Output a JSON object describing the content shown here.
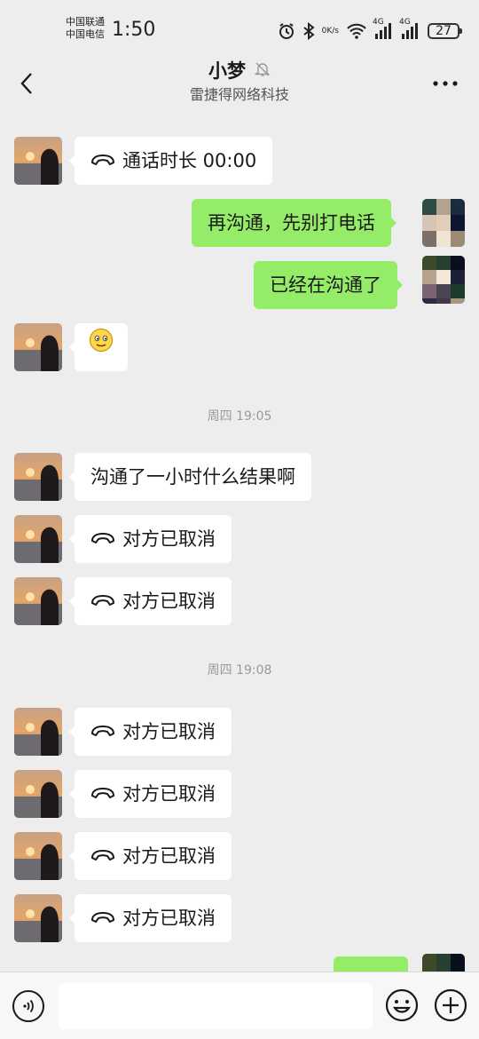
{
  "status_bar": {
    "carrier_1": "中国联通",
    "carrier_2": "中国电信",
    "time": "1:50",
    "speed_value": "0",
    "speed_unit": "K/s",
    "network_1": "4G",
    "network_2": "4G",
    "battery": "27"
  },
  "header": {
    "title": "小梦",
    "subtitle": "雷捷得网络科技"
  },
  "messages": [
    {
      "side": "left",
      "type": "call",
      "text": "通话时长 00:00"
    },
    {
      "side": "right",
      "type": "text",
      "text": "再沟通，先别打电话"
    },
    {
      "side": "right",
      "type": "text",
      "text": "已经在沟通了"
    },
    {
      "side": "left",
      "type": "emoji",
      "text": ""
    },
    {
      "type": "timestamp",
      "text": "周四 19:05"
    },
    {
      "side": "left",
      "type": "text",
      "text": "沟通了一小时什么结果啊"
    },
    {
      "side": "left",
      "type": "call",
      "text": "对方已取消"
    },
    {
      "side": "left",
      "type": "call",
      "text": "对方已取消"
    },
    {
      "type": "timestamp",
      "text": "周四 19:08"
    },
    {
      "side": "left",
      "type": "call",
      "text": "对方已取消"
    },
    {
      "side": "left",
      "type": "call",
      "text": "对方已取消"
    },
    {
      "side": "left",
      "type": "call",
      "text": "对方已取消"
    },
    {
      "side": "left",
      "type": "call",
      "text": "对方已取消"
    },
    {
      "side": "right",
      "type": "text",
      "text": ""
    }
  ],
  "colors": {
    "background": "#ededed",
    "bubble_self": "#95ec69",
    "bubble_other": "#ffffff"
  },
  "icons": {
    "back": "chevron-left-icon",
    "muted": "bell-off-icon",
    "more": "more-dots-icon",
    "call": "phone-hangup-icon",
    "voice": "voice-icon",
    "emoji": "smiley-icon",
    "plus": "plus-icon"
  }
}
